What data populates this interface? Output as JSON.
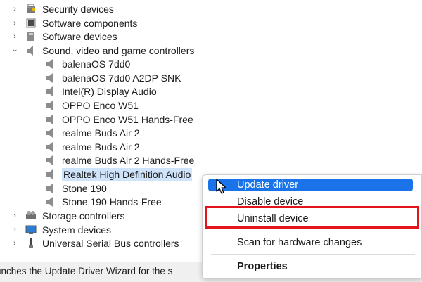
{
  "tree": {
    "categories_top": [
      {
        "label": "Security devices",
        "icon": "security-device-icon"
      },
      {
        "label": "Software components",
        "icon": "software-component-icon"
      },
      {
        "label": "Software devices",
        "icon": "software-device-icon"
      },
      {
        "label": "Sound, video and game controllers",
        "icon": "speaker-icon"
      }
    ],
    "sound_devices": [
      "balenaOS 7dd0",
      "balenaOS 7dd0 A2DP SNK",
      "Intel(R) Display Audio",
      "OPPO Enco W51",
      "OPPO Enco W51 Hands-Free",
      "realme Buds Air 2",
      "realme Buds Air 2",
      "realme Buds Air 2 Hands-Free",
      "Realtek High Definition Audio",
      "Stone 190",
      "Stone 190 Hands-Free"
    ],
    "categories_bottom": [
      {
        "label": "Storage controllers",
        "icon": "storage-icon"
      },
      {
        "label": "System devices",
        "icon": "system-device-icon"
      },
      {
        "label": "Universal Serial Bus controllers",
        "icon": "usb-icon"
      }
    ]
  },
  "context_menu": {
    "update_driver": "Update driver",
    "disable_device": "Disable device",
    "uninstall_device": "Uninstall device",
    "scan_hardware": "Scan for hardware changes",
    "properties": "Properties"
  },
  "status_bar": {
    "text": "unches the Update Driver Wizard for the s"
  },
  "colors": {
    "menu_hover": "#1a73e8",
    "highlight_box": "#e3141c",
    "selection": "#cfe3fb"
  }
}
